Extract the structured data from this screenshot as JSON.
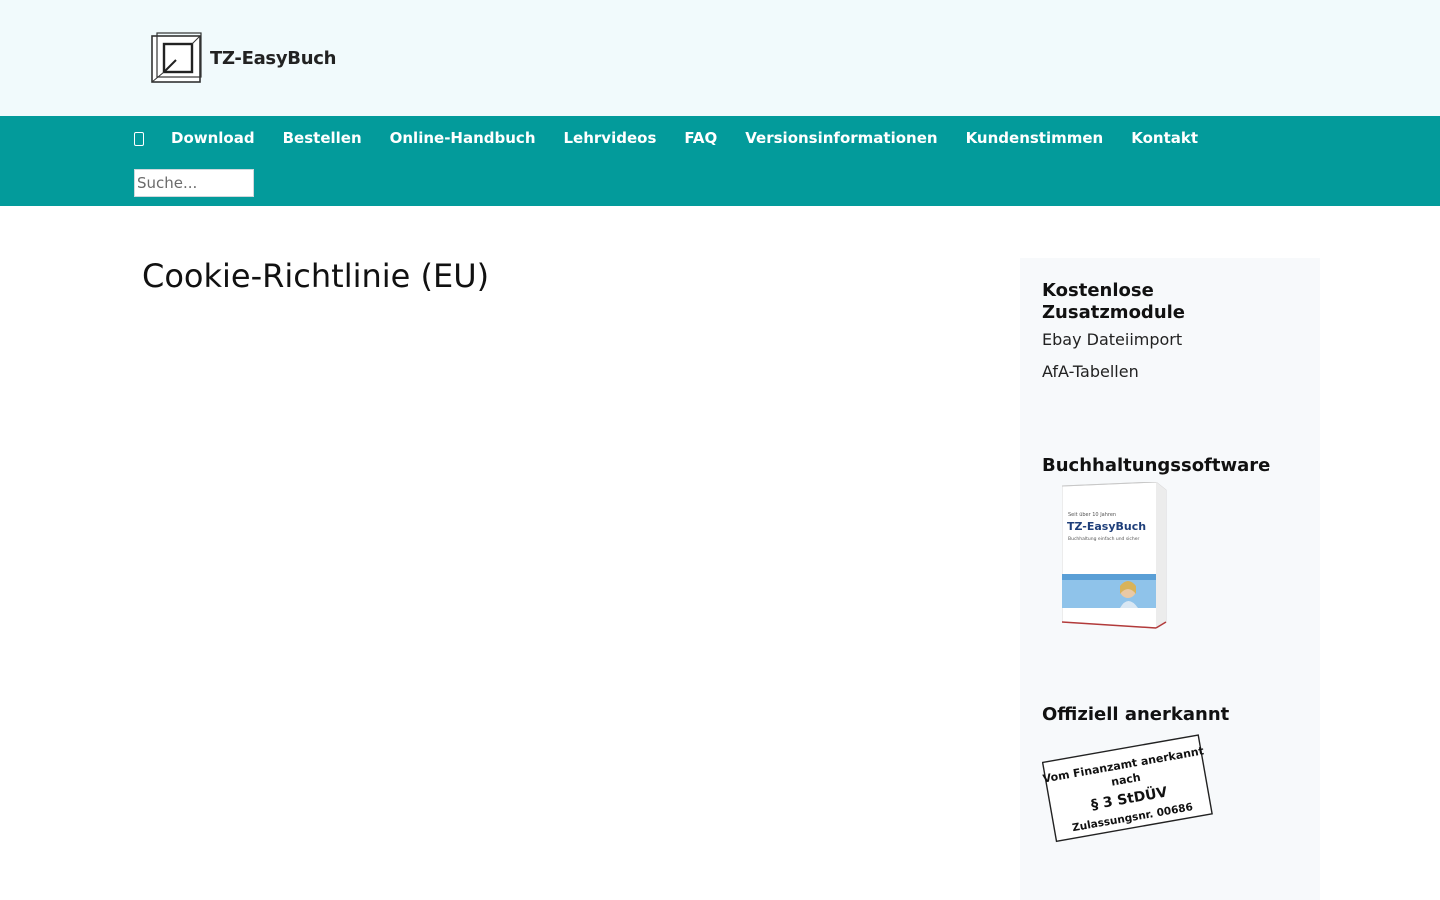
{
  "header": {
    "logo_text": "TZ-EasyBuch"
  },
  "nav": {
    "items": [
      "Download",
      "Bestellen",
      "Online-Handbuch",
      "Lehrvideos",
      "FAQ",
      "Versionsinformationen",
      "Kundenstimmen",
      "Kontakt"
    ],
    "search_placeholder": "Suche..."
  },
  "main": {
    "title": "Cookie-Richtlinie (EU)"
  },
  "sidebar": {
    "modules_title": "Kostenlose Zusatzmodule",
    "links": [
      "Ebay Dateiimport",
      "AfA-Tabellen"
    ],
    "software_title": "Buchhaltungssoftware",
    "recognized_title": "Offiziell anerkannt",
    "boxshot": {
      "line1": "Seit über 10 Jahren",
      "product": "TZ-EasyBuch",
      "tagline": "Buchhaltung einfach und sicher"
    },
    "stamp": {
      "line1": "Vom Finanzamt anerkannt",
      "line2": "nach",
      "line3": "§ 3 StDÜV",
      "line4": "Zulassungsnr. 00686"
    }
  },
  "colors": {
    "nav_bg": "#039b9b",
    "header_bg": "#f1fafc",
    "sidebar_bg": "#f7f9fb"
  }
}
